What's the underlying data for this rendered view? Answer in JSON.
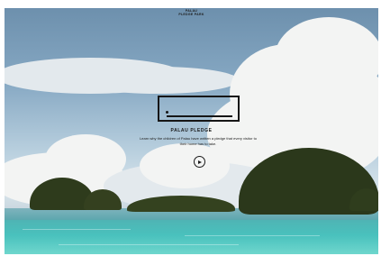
{
  "header": {
    "line1": "PALAU",
    "line2": "PLEDGE PARK"
  },
  "hero": {
    "title": "PALAU PLEDGE",
    "description": "Learn why the children of Palau have written a pledge that every visitor to their home has to take."
  },
  "controls": {
    "play_icon": "play-icon"
  }
}
